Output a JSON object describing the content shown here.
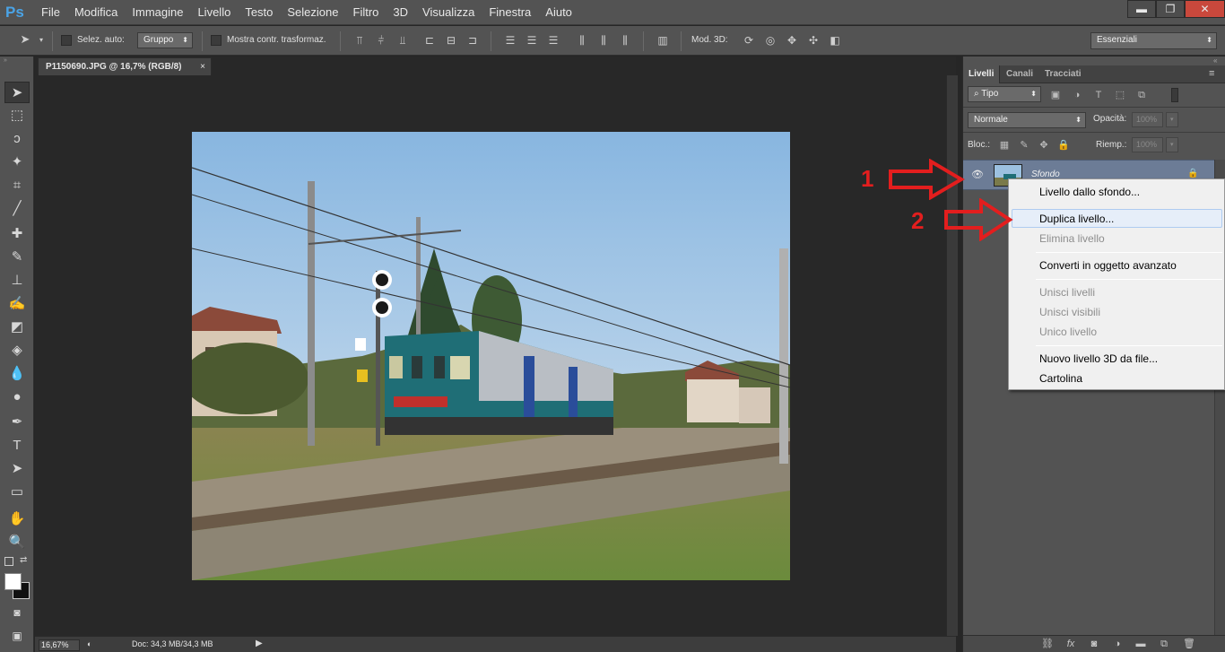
{
  "app": {
    "logo": "Ps"
  },
  "menu": [
    "File",
    "Modifica",
    "Immagine",
    "Livello",
    "Testo",
    "Selezione",
    "Filtro",
    "3D",
    "Visualizza",
    "Finestra",
    "Aiuto"
  ],
  "window_controls": {
    "minimize": "▬",
    "restore": "❐",
    "close": "✕"
  },
  "options_bar": {
    "auto_select_label": "Selez. auto:",
    "auto_select_value": "Gruppo",
    "show_transform_label": "Mostra contr. trasformaz.",
    "mode3d_label": "Mod. 3D:",
    "workspace": "Essenziali"
  },
  "document": {
    "tab_title": "P1150690.JPG @ 16,7% (RGB/8)",
    "tab_close": "×",
    "zoom": "16,67%",
    "doc_info": "Doc: 34,3 MB/34,3 MB"
  },
  "layers_panel": {
    "tabs": [
      "Livelli",
      "Canali",
      "Tracciati"
    ],
    "active_tab": "Livelli",
    "filter_value": "Tipo",
    "blend_mode": "Normale",
    "opacity_label": "Opacità:",
    "opacity_value": "100%",
    "lock_label": "Bloc.:",
    "fill_label": "Riemp.:",
    "fill_value": "100%",
    "layer_name": "Sfondo"
  },
  "context_menu": {
    "items": [
      {
        "label": "Livello dallo sfondo...",
        "enabled": true
      },
      {
        "label": "Duplica livello...",
        "enabled": true,
        "highlighted": true
      },
      {
        "label": "Elimina livello",
        "enabled": false
      },
      {
        "label": "Converti in oggetto avanzato",
        "enabled": true
      },
      {
        "label": "Unisci livelli",
        "enabled": false
      },
      {
        "label": "Unisci visibili",
        "enabled": false
      },
      {
        "label": "Unico livello",
        "enabled": false
      },
      {
        "label": "Nuovo livello 3D da file...",
        "enabled": true
      },
      {
        "label": "Cartolina",
        "enabled": true
      }
    ]
  },
  "annotations": {
    "step1": "1",
    "step2": "2",
    "color": "#e31e1e"
  },
  "colors": {
    "ui_bg": "#535353",
    "canvas_bg": "#282828",
    "selected_layer": "#6c7c96",
    "ps_blue": "#4aa3e6"
  }
}
